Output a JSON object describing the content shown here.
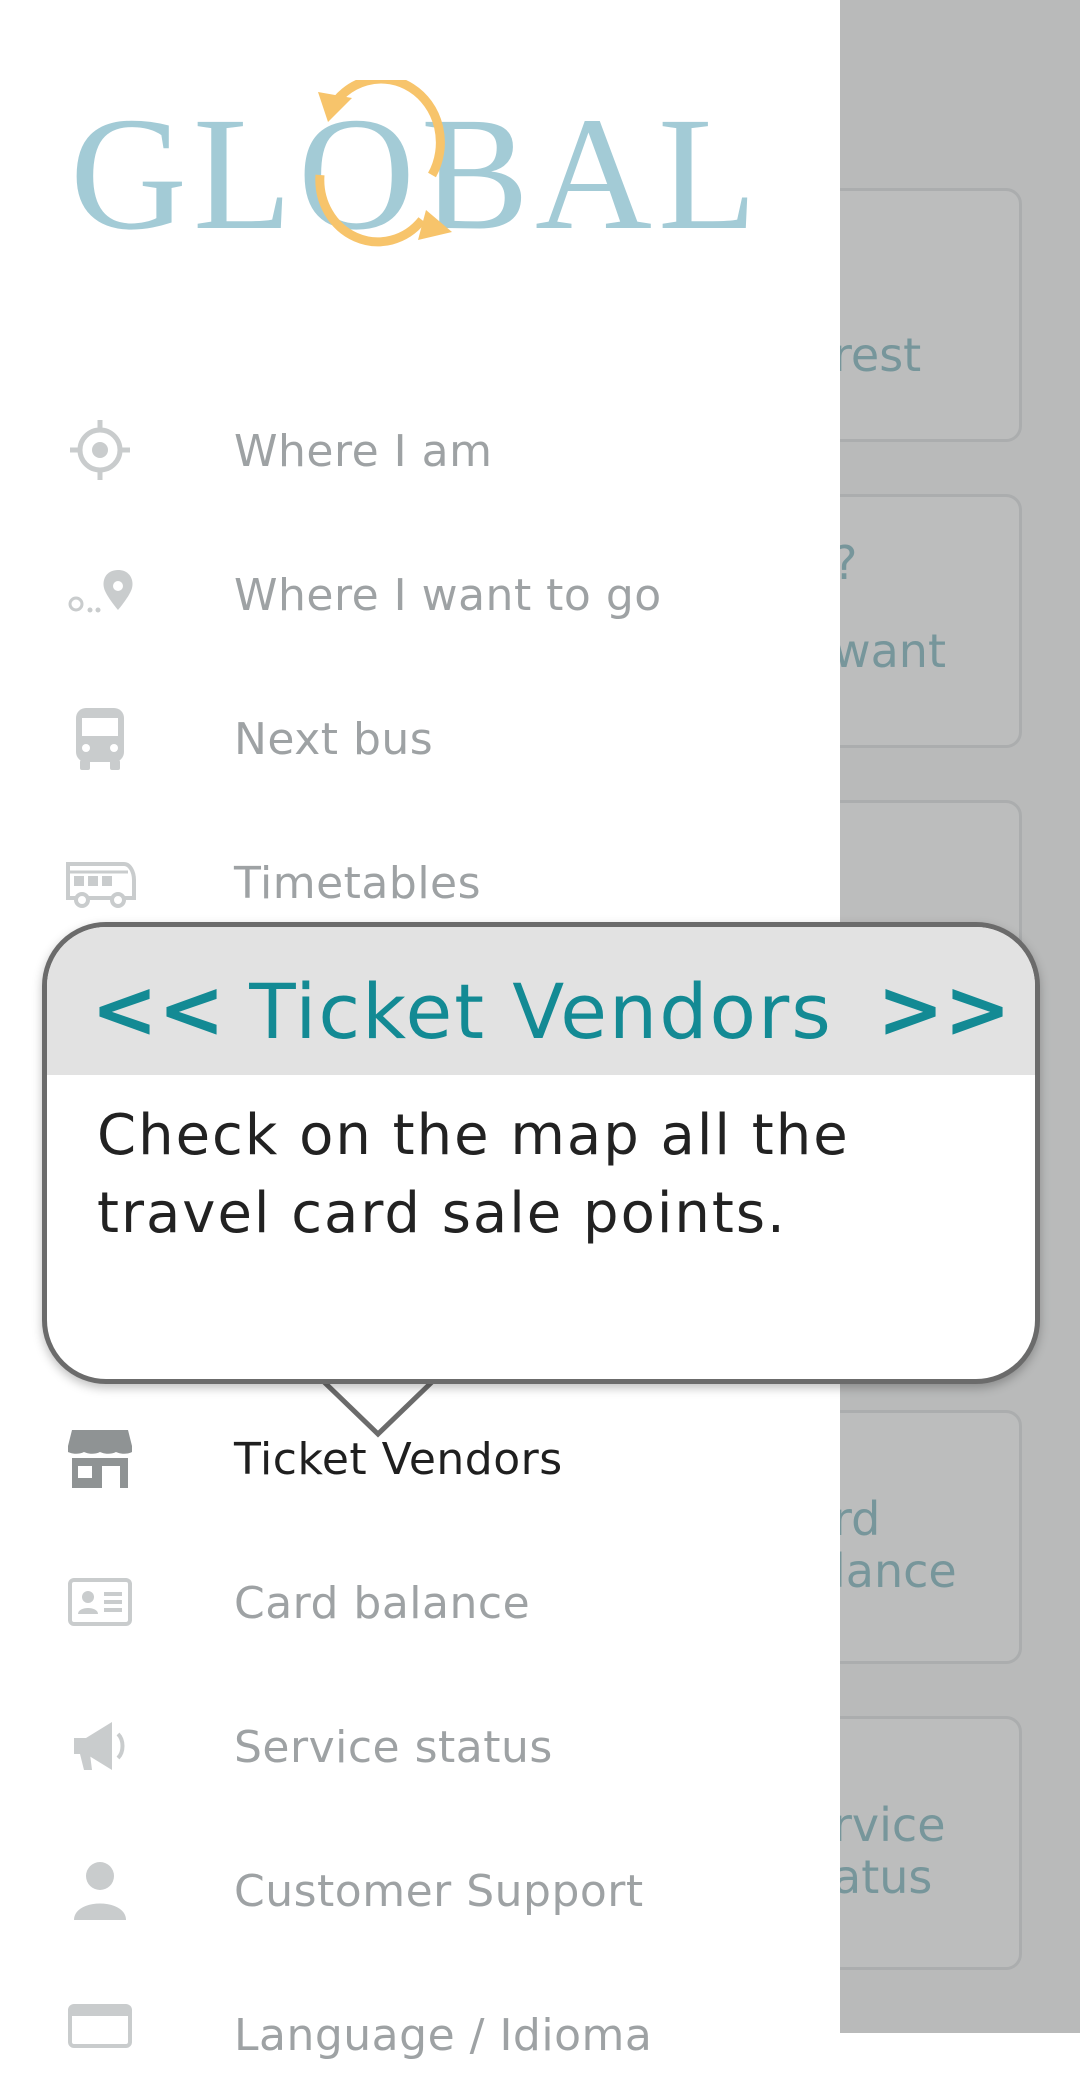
{
  "logo": {
    "text": "GLOBAL"
  },
  "menu": {
    "items": [
      {
        "label": "Where I am",
        "icon": "target-icon"
      },
      {
        "label": "Where I want to go",
        "icon": "route-pin-icon"
      },
      {
        "label": "Next bus",
        "icon": "bus-icon"
      },
      {
        "label": "Timetables",
        "icon": "coach-icon"
      },
      {
        "label": "Ticket Vendors",
        "icon": "storefront-icon",
        "active": true
      },
      {
        "label": "Card balance",
        "icon": "id-card-icon"
      },
      {
        "label": "Service status",
        "icon": "megaphone-icon"
      },
      {
        "label": "Customer Support",
        "icon": "user-icon"
      },
      {
        "label": "Language / Idioma",
        "icon": "language-icon"
      }
    ]
  },
  "tooltip": {
    "title": "Ticket Vendors",
    "prev": "<<",
    "next": ">>",
    "body": "Check on the map all the travel card sale points."
  },
  "background_cards": {
    "card1": [
      "rest"
    ],
    "card2": [
      "?",
      "want"
    ],
    "card3": [
      "rd",
      "lance"
    ],
    "card4": [
      "rvice",
      "atus"
    ]
  },
  "colors": {
    "accent": "#138a94",
    "menu_text": "#9ea2a4",
    "active_text": "#1f1f1f",
    "logo_blue": "#a3cbd6",
    "logo_orange": "#f7c46b"
  }
}
